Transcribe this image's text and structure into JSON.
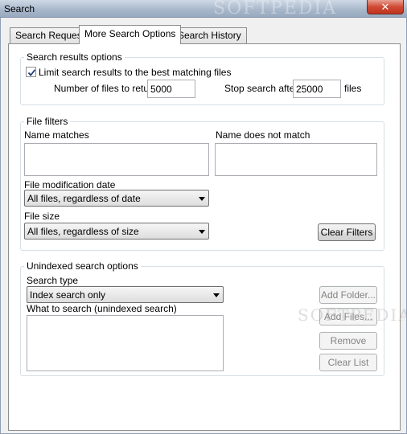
{
  "window": {
    "title": "Search",
    "close_glyph": "✕",
    "watermark": "SOFTPEDIA"
  },
  "tabs": [
    {
      "label": "Search Request",
      "active": false
    },
    {
      "label": "More Search Options",
      "active": true
    },
    {
      "label": "Search History",
      "active": false
    }
  ],
  "search_results_options": {
    "legend": "Search results options",
    "limit_checkbox_label": "Limit search results to the best matching files",
    "limit_checked": true,
    "files_to_return_label": "Number of files to return",
    "files_to_return_value": "5000",
    "stop_after_label": "Stop search after",
    "stop_after_value": "25000",
    "files_unit_label": "files"
  },
  "file_filters": {
    "legend": "File filters",
    "name_matches_label": "Name matches",
    "name_not_match_label": "Name does not match",
    "mod_date_label": "File modification date",
    "mod_date_value": "All files, regardless of date",
    "file_size_label": "File size",
    "file_size_value": "All files, regardless of size",
    "clear_filters_button": "Clear Filters"
  },
  "unindexed_options": {
    "legend": "Unindexed search options",
    "search_type_label": "Search type",
    "search_type_value": "Index search only",
    "what_to_search_label": "What to search (unindexed search)",
    "add_folder_button": "Add Folder...",
    "add_files_button": "Add Files...",
    "remove_button": "Remove",
    "clear_list_button": "Clear List"
  },
  "icons": {
    "checkbox_check": "check-icon",
    "combo_arrow": "chevron-down-icon",
    "close": "close-icon"
  }
}
